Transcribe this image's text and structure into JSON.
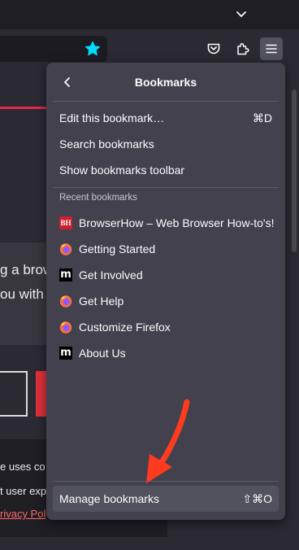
{
  "toolbar": {
    "icons": [
      "chevron-down-icon",
      "star-icon",
      "pocket-icon",
      "extensions-icon",
      "menu-icon"
    ],
    "star_color": "#00ddff"
  },
  "background_page": {
    "text_line_1": "g a brow",
    "text_line_2": "ou with",
    "footer_line_1": "e uses co",
    "footer_line_2": "t user exp",
    "footer_link": "rivacy Pol",
    "accent_color": "#e22850"
  },
  "panel": {
    "title": "Bookmarks",
    "actions": [
      {
        "label": "Edit this bookmark…",
        "shortcut": "⌘D"
      },
      {
        "label": "Search bookmarks",
        "shortcut": ""
      },
      {
        "label": "Show bookmarks toolbar",
        "shortcut": ""
      }
    ],
    "recent_heading": "Recent bookmarks",
    "bookmarks": [
      {
        "label": "BrowserHow – Web Browser How-to's!",
        "icon": "browserhow-icon",
        "icon_text": "BH"
      },
      {
        "label": "Getting Started",
        "icon": "firefox-icon"
      },
      {
        "label": "Get Involved",
        "icon": "mozilla-icon",
        "icon_text": "m"
      },
      {
        "label": "Get Help",
        "icon": "firefox-icon"
      },
      {
        "label": "Customize Firefox",
        "icon": "firefox-icon"
      },
      {
        "label": "About Us",
        "icon": "mozilla-icon",
        "icon_text": "m"
      }
    ],
    "footer": {
      "label": "Manage bookmarks",
      "shortcut": "⇧⌘O"
    }
  },
  "annotation": {
    "color": "#ff3b1f",
    "icon": "red-arrow-icon"
  }
}
